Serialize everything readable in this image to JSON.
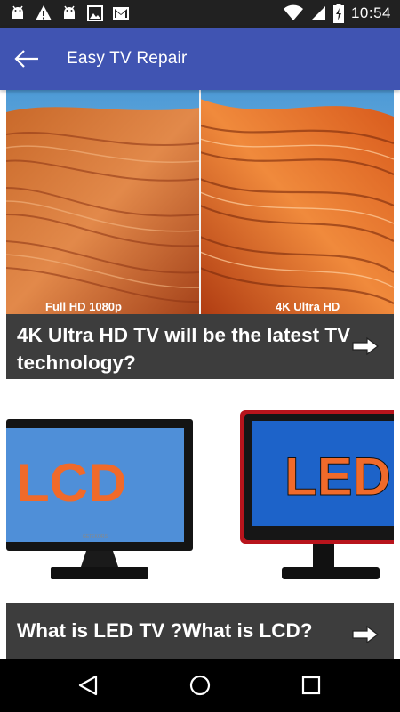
{
  "status_bar": {
    "time": "10:54",
    "icons": [
      "android-icon",
      "warning-icon",
      "android-icon",
      "image-icon",
      "gmail-icon",
      "wifi-icon",
      "signal-icon",
      "battery-icon"
    ]
  },
  "app_bar": {
    "title": "Easy TV Repair",
    "back_icon": "arrow-left-icon"
  },
  "cards": [
    {
      "image_labels": {
        "left": "Full HD 1080p",
        "right": "4K Ultra HD"
      },
      "title": "4K Ultra HD TV will be the latest TV technology?",
      "action_icon": "arrow-right-icon"
    },
    {
      "image_labels": {
        "left": "LCD",
        "right": "LED",
        "brand": "GETEKORS"
      },
      "title": "What is LED TV ?What is LCD?",
      "action_icon": "arrow-right-icon"
    }
  ],
  "nav_bar": {
    "icons": [
      "back-triangle-icon",
      "home-circle-icon",
      "recents-square-icon"
    ]
  },
  "colors": {
    "app_bar": "#4054b2",
    "status_bar": "#212121",
    "caption_bg": "#3d3d3d",
    "lcd_text": "#f06a2a",
    "screen_blue": "#4f8fd8"
  }
}
